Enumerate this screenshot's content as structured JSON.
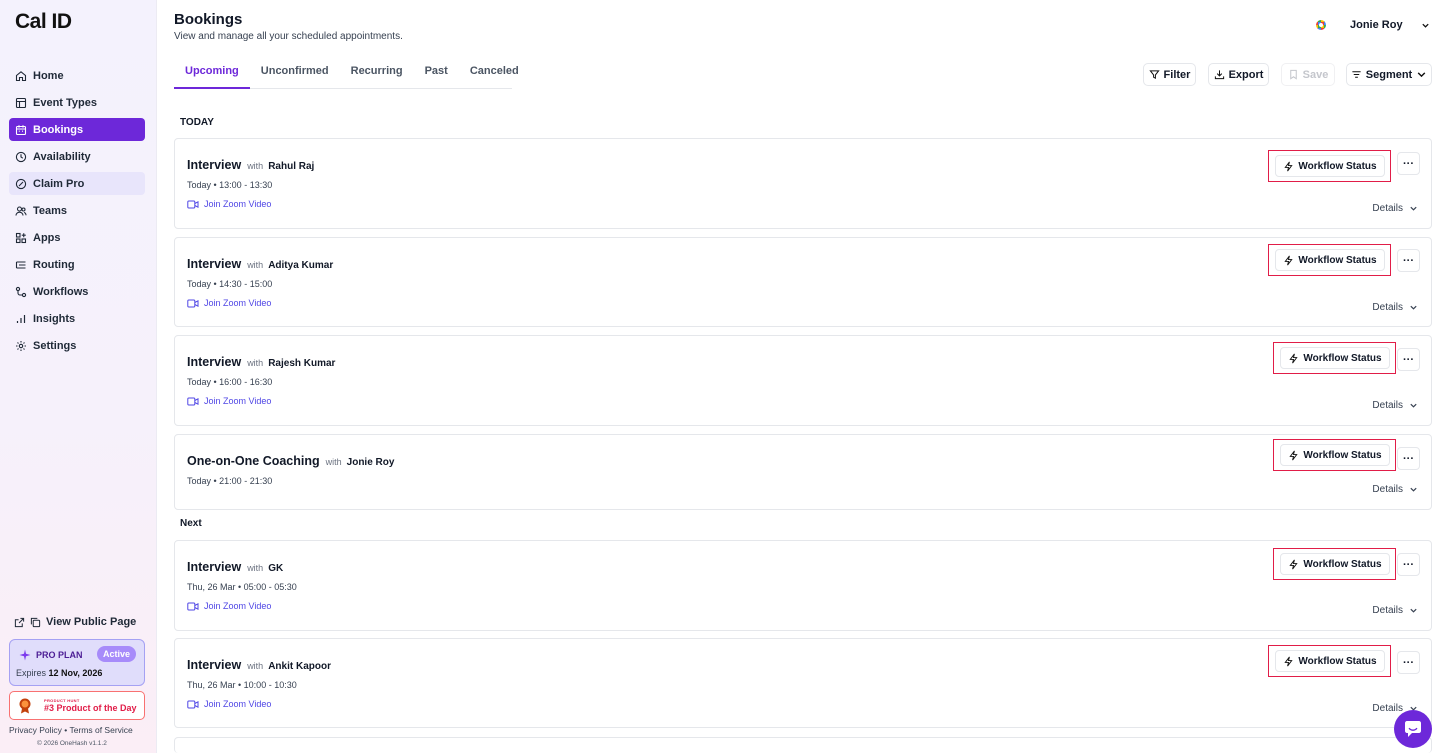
{
  "app": {
    "logo": "Cal ID"
  },
  "sidebar": {
    "items": [
      {
        "label": "Home",
        "icon": "home-icon"
      },
      {
        "label": "Event Types",
        "icon": "event-types-icon"
      },
      {
        "label": "Bookings",
        "icon": "calendar-icon",
        "active": true
      },
      {
        "label": "Availability",
        "icon": "clock-icon"
      },
      {
        "label": "Claim Pro",
        "icon": "gauge-icon"
      },
      {
        "label": "Teams",
        "icon": "users-icon"
      },
      {
        "label": "Apps",
        "icon": "grid-plus-icon"
      },
      {
        "label": "Routing",
        "icon": "routing-icon"
      },
      {
        "label": "Workflows",
        "icon": "workflow-icon"
      },
      {
        "label": "Insights",
        "icon": "bar-chart-icon"
      },
      {
        "label": "Settings",
        "icon": "gear-icon"
      }
    ],
    "view_public_page": "View Public Page",
    "plan": {
      "name": "PRO PLAN",
      "status": "Active",
      "expires_prefix": "Expires",
      "expires_date": "12 Nov, 2026"
    },
    "product_hunt": {
      "small": "PRODUCT HUNT",
      "big": "#3 Product of the Day"
    },
    "footer": {
      "privacy": "Privacy Policy",
      "sep": "•",
      "terms": "Terms of Service",
      "copyright": "© 2026 OneHash v1.1.2"
    }
  },
  "header": {
    "title": "Bookings",
    "subtitle": "View and manage all your scheduled appointments.",
    "user_name": "Jonie Roy"
  },
  "tabs": [
    "Upcoming",
    "Unconfirmed",
    "Recurring",
    "Past",
    "Canceled"
  ],
  "toolbar": {
    "filter": "Filter",
    "export": "Export",
    "save": "Save",
    "segment": "Segment"
  },
  "sections": {
    "today": "TODAY",
    "next": "Next"
  },
  "card_labels": {
    "with": "with",
    "join": "Join Zoom Video",
    "workflow": "Workflow Status",
    "details": "Details",
    "more": "···"
  },
  "bookings": [
    {
      "title": "Interview",
      "person": "Rahul Raj",
      "when": "Today  •  13:00 - 13:30",
      "zoom": true
    },
    {
      "title": "Interview",
      "person": "Aditya Kumar",
      "when": "Today  •  14:30 - 15:00",
      "zoom": true
    },
    {
      "title": "Interview",
      "person": "Rajesh Kumar",
      "when": "Today  •  16:00 - 16:30",
      "zoom": true
    },
    {
      "title": "One-on-One Coaching",
      "person": "Jonie Roy",
      "when": "Today  •  21:00 - 21:30",
      "zoom": false
    },
    {
      "title": "Interview",
      "person": "GK",
      "when": "Thu, 26 Mar  •  05:00 - 05:30",
      "zoom": true
    },
    {
      "title": "Interview",
      "person": "Ankit Kapoor",
      "when": "Thu, 26 Mar  •  10:00 - 10:30",
      "zoom": true
    }
  ],
  "colors": {
    "accent": "#6d28d9",
    "highlight_border": "#e11d48",
    "link": "#4f46e5"
  }
}
